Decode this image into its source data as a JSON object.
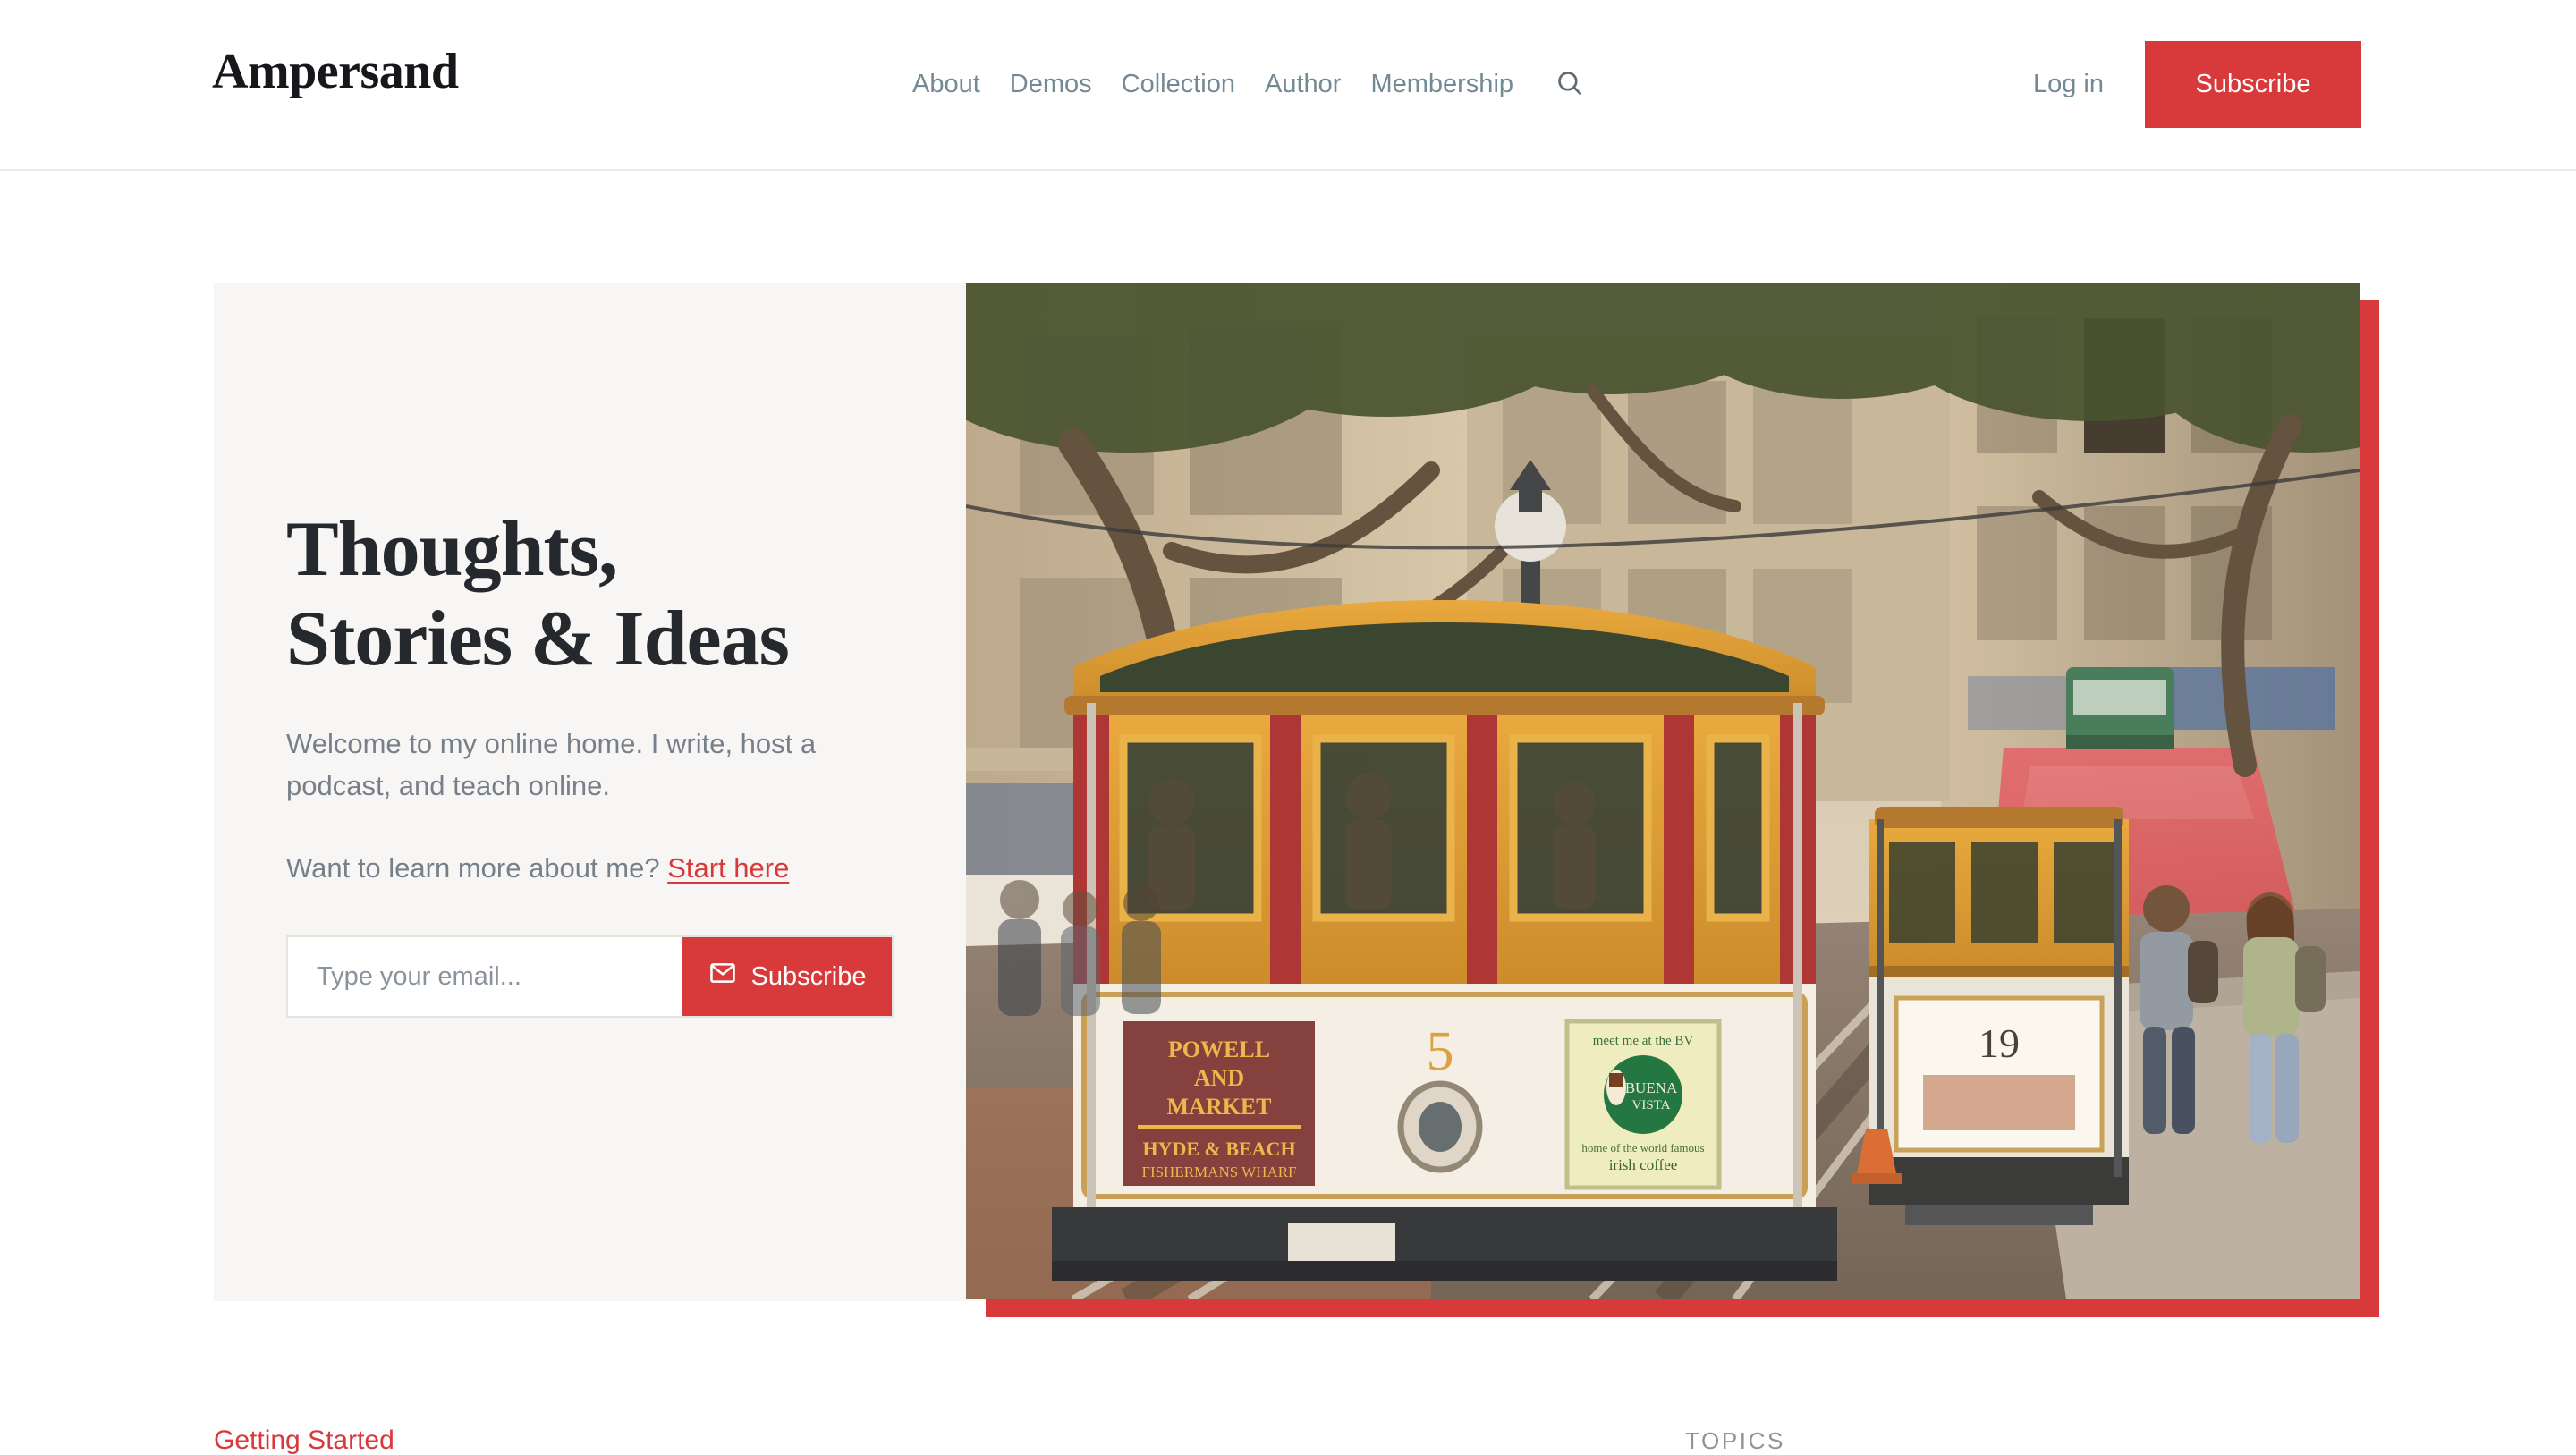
{
  "brand": {
    "name": "Ampersand"
  },
  "header": {
    "nav": [
      {
        "label": "About",
        "name": "nav-about"
      },
      {
        "label": "Demos",
        "name": "nav-demos"
      },
      {
        "label": "Collection",
        "name": "nav-collection"
      },
      {
        "label": "Author",
        "name": "nav-author"
      },
      {
        "label": "Membership",
        "name": "nav-membership"
      }
    ],
    "search_icon": "search-icon",
    "login_label": "Log in",
    "subscribe_label": "Subscribe"
  },
  "hero": {
    "title_line1": "Thoughts,",
    "title_line2": "Stories & Ideas",
    "subtitle": "Welcome to my online home. I write, host a podcast, and teach online.",
    "more_prefix": "Want to learn more about me? ",
    "more_link": "Start here",
    "email_placeholder": "Type your email...",
    "email_value": "",
    "form_subscribe_label": "Subscribe",
    "mail_icon": "mail-icon",
    "image_alt": "San Francisco cable car number 5 on Powell and Market line"
  },
  "below_fold": {
    "getting_started": "Getting Started",
    "topics_label": "TOPICS"
  },
  "colors": {
    "accent_red": "#d8393b",
    "panel_gray": "#f7f6f4",
    "text_dark": "#25292e",
    "text_muted": "#77808a",
    "nav_muted": "#738a94",
    "border_light": "#ebebeb"
  }
}
